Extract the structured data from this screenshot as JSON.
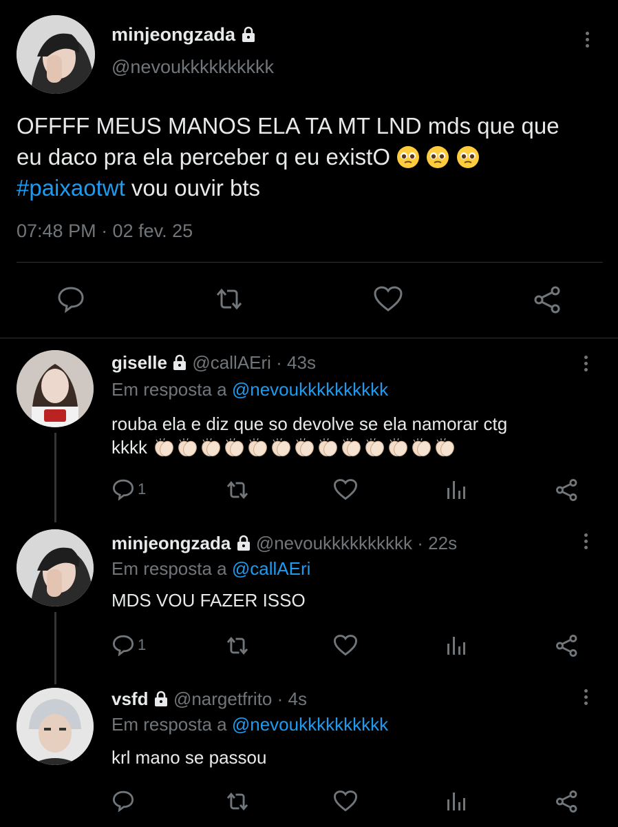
{
  "main_tweet": {
    "display_name": "minjeongzada",
    "handle": "@nevoukkkkkkkkkk",
    "text_line1": "OFFFF MEUS MANOS ELA TA MT LND mds que que",
    "text_line2": "eu daco pra ela perceber q eu existO",
    "hashtag": "#paixaotwt",
    "text_line3_rest": " vou ouvir bts",
    "timestamp": "07:48 PM · 02 fev. 25",
    "emojis": [
      "pleading-face",
      "pleading-face",
      "pleading-face"
    ]
  },
  "replies": [
    {
      "display_name": "giselle",
      "handle": "@callAEri",
      "time": " · 43s",
      "reply_prefix": "Em resposta a ",
      "reply_to": "@nevoukkkkkkkkkk",
      "text_line1": "rouba ela e diz que so devolve se ela namorar ctg",
      "text_line2": "kkkk",
      "clap_count": 13,
      "reply_count": "1"
    },
    {
      "display_name": "minjeongzada",
      "handle": "@nevoukkkkkkkkkk",
      "time": " · 22s",
      "reply_prefix": "Em resposta a ",
      "reply_to": "@callAEri",
      "text_line1": "MDS VOU FAZER ISSO",
      "reply_count": "1"
    },
    {
      "display_name": "vsfd",
      "handle": "@nargetfrito",
      "time": " · 4s",
      "reply_prefix": "Em resposta a ",
      "reply_to": "@nevoukkkkkkkkkk",
      "text_line1": "krl mano se passou",
      "reply_count": ""
    }
  ],
  "icons": {
    "reply": "speech-bubble-icon",
    "retweet": "retweet-icon",
    "like": "heart-icon",
    "views": "bar-chart-icon",
    "share": "share-nodes-icon",
    "lock": "padlock-icon",
    "more": "vertical-ellipsis-icon"
  },
  "colors": {
    "background": "#000000",
    "text": "#e7e9ea",
    "secondary": "#71767b",
    "link": "#1d9bf0"
  }
}
